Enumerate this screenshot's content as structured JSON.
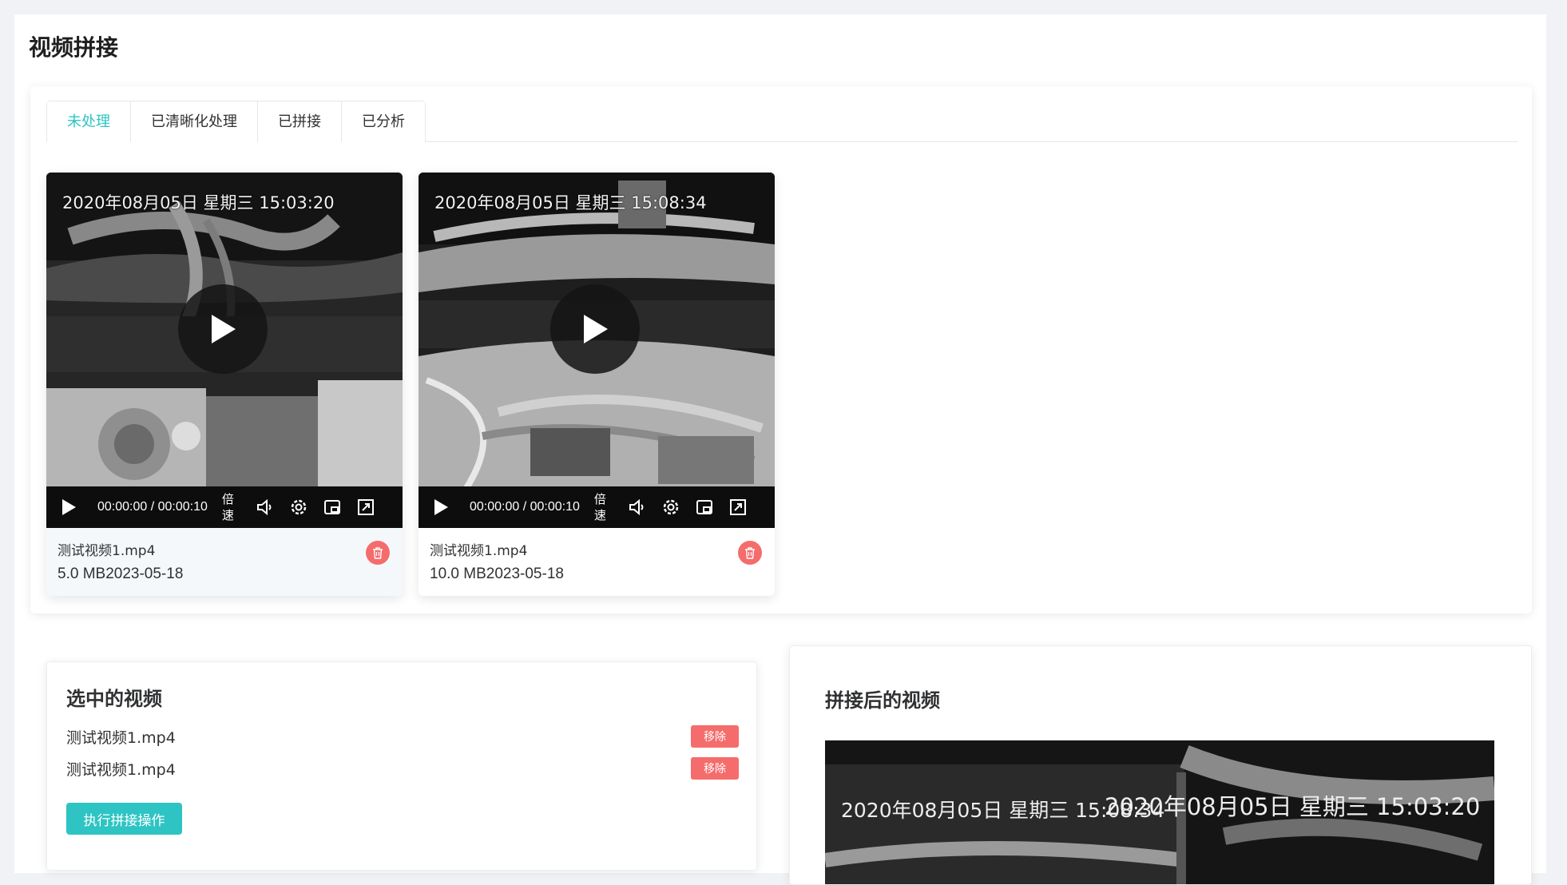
{
  "page": {
    "title": "视频拼接"
  },
  "tabs": [
    {
      "label": "未处理",
      "active": true
    },
    {
      "label": "已清晰化处理",
      "active": false
    },
    {
      "label": "已拼接",
      "active": false
    },
    {
      "label": "已分析",
      "active": false
    }
  ],
  "videos": [
    {
      "overlay_timestamp": "2020年08月05日 星期三 15:03:20",
      "time": "00:00:00 / 00:00:10",
      "speed_label": "倍速",
      "file_name": "测试视频1.mp4",
      "meta": "5.0 MB2023-05-18"
    },
    {
      "overlay_timestamp": "2020年08月05日 星期三 15:08:34",
      "time": "00:00:00 / 00:00:10",
      "speed_label": "倍速",
      "file_name": "测试视频1.mp4",
      "meta": "10.0 MB2023-05-18"
    }
  ],
  "selected": {
    "title": "选中的视频",
    "items": [
      {
        "name": "测试视频1.mp4",
        "remove_label": "移除"
      },
      {
        "name": "测试视频1.mp4",
        "remove_label": "移除"
      }
    ],
    "execute_label": "执行拼接操作"
  },
  "result": {
    "title": "拼接后的视频",
    "overlay_left": "2020年08月05日 星期三 15:08:34",
    "overlay_right": "2020年08月05日 星期三 15:03:20"
  },
  "colors": {
    "accent": "#2ec4c3",
    "danger": "#f56c6c"
  },
  "icons": [
    "play-icon",
    "volume-icon",
    "settings-icon",
    "picture-in-picture-icon",
    "fullscreen-icon",
    "delete-icon"
  ]
}
